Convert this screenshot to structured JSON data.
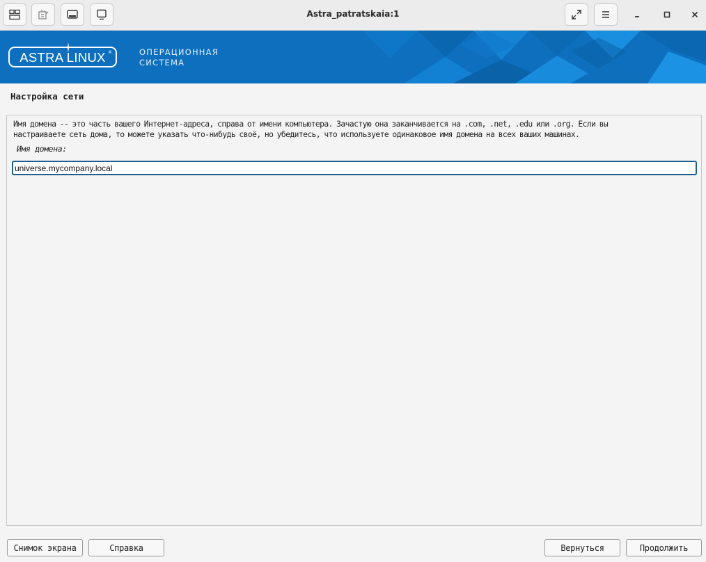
{
  "window": {
    "title": "Astra_patratskaia:1",
    "toolbar_icons": [
      "remote-desktop-icon",
      "keyboard-input-icon",
      "screenshot-tray-icon",
      "display-icon"
    ],
    "controls": [
      "fullscreen-icon",
      "menu-icon",
      "minimize-icon",
      "maximize-icon",
      "close-icon"
    ]
  },
  "banner": {
    "logo_text": "ASTRA LINUX",
    "logo_mark": "®",
    "subtitle_line1": "ОПЕРАЦИОННАЯ",
    "subtitle_line2": "СИСТЕМА",
    "background_color": "#0d6fbd"
  },
  "page": {
    "title": "Настройка сети",
    "description_line1": "Имя домена -- это часть вашего Интернет-адреса, справа от имени компьютера. Зачастую она заканчивается на .com, .net, .edu или .org. Если вы",
    "description_line2": "настраиваете сеть дома, то можете указать что-нибудь своё, но убедитесь, что используете одинаковое имя домена на всех ваших машинах.",
    "field_label": "Имя домена:",
    "field_value": "universe.mycompany.local",
    "input_border_color": "#1f5e8f"
  },
  "buttons": {
    "screenshot": "Снимок экрана",
    "help": "Справка",
    "back": "Вернуться",
    "continue": "Продолжить"
  }
}
